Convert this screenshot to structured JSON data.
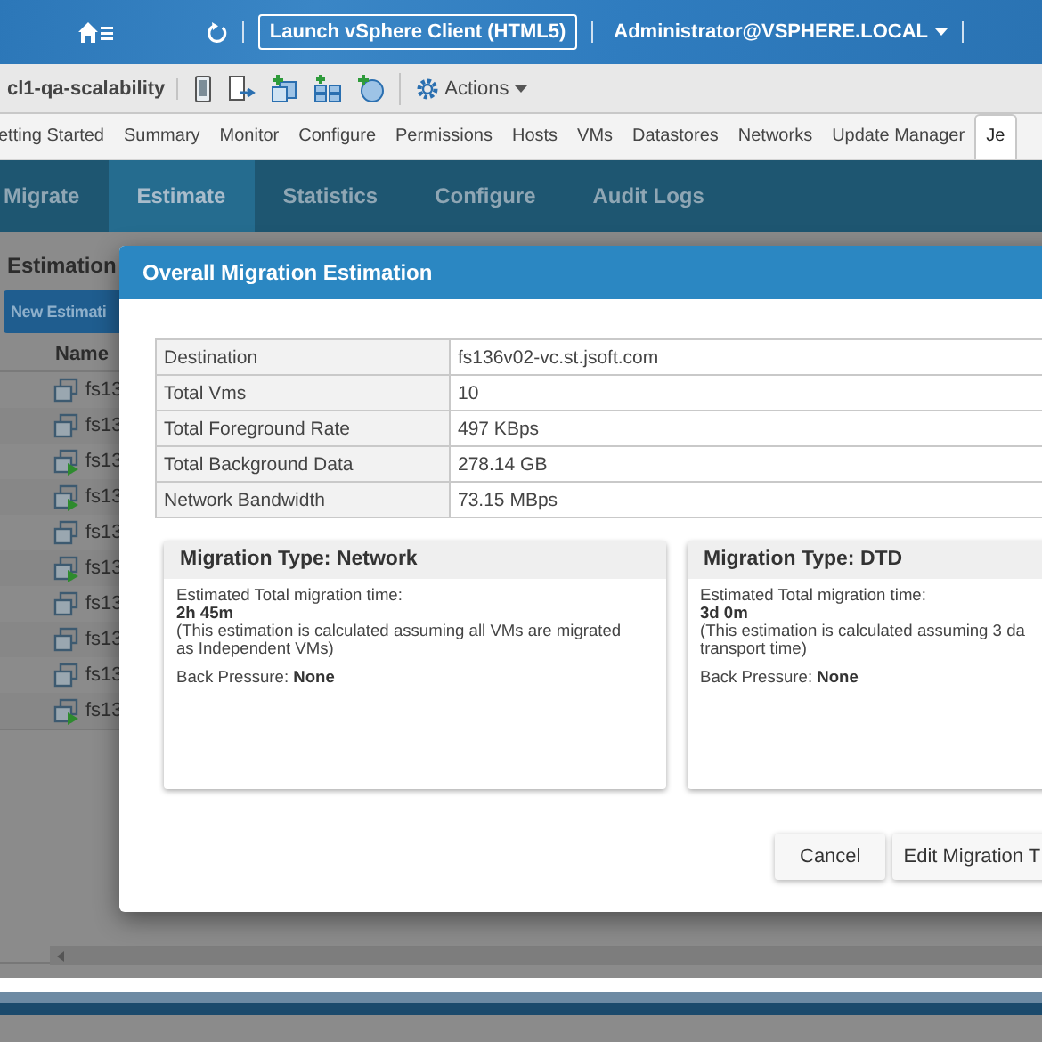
{
  "top_bar": {
    "launch_button": "Launch vSphere Client (HTML5)",
    "user_menu": "Administrator@VSPHERE.LOCAL"
  },
  "toolbar": {
    "object_name": "cl1-qa-scalability",
    "actions": "Actions"
  },
  "tabs": [
    {
      "label": "etting Started",
      "selected": false
    },
    {
      "label": "Summary",
      "selected": false
    },
    {
      "label": "Monitor",
      "selected": false
    },
    {
      "label": "Configure",
      "selected": false
    },
    {
      "label": "Permissions",
      "selected": false
    },
    {
      "label": "Hosts",
      "selected": false
    },
    {
      "label": "VMs",
      "selected": false
    },
    {
      "label": "Datastores",
      "selected": false
    },
    {
      "label": "Networks",
      "selected": false
    },
    {
      "label": "Update Manager",
      "selected": false
    },
    {
      "label": "Je",
      "selected": true
    }
  ],
  "subnav": [
    {
      "label": "Migrate",
      "selected": false
    },
    {
      "label": "Estimate",
      "selected": true
    },
    {
      "label": "Statistics",
      "selected": false
    },
    {
      "label": "Configure",
      "selected": false
    },
    {
      "label": "Audit Logs",
      "selected": false
    }
  ],
  "estimation_panel": {
    "title": "Estimation",
    "new_button": "New Estimati",
    "column": "Name",
    "rows": [
      {
        "name": "fs13",
        "powered_on": false
      },
      {
        "name": "fs13",
        "powered_on": false
      },
      {
        "name": "fs13",
        "powered_on": true
      },
      {
        "name": "fs13",
        "powered_on": true
      },
      {
        "name": "fs13",
        "powered_on": false
      },
      {
        "name": "fs13",
        "powered_on": true
      },
      {
        "name": "fs13",
        "powered_on": false
      },
      {
        "name": "fs13",
        "powered_on": false
      },
      {
        "name": "fs13",
        "powered_on": false
      },
      {
        "name": "fs13",
        "powered_on": true
      }
    ]
  },
  "dialog": {
    "title": "Overall Migration Estimation",
    "summary": [
      {
        "label": "Destination",
        "value": "fs136v02-vc.st.jsoft.com"
      },
      {
        "label": "Total Vms",
        "value": "10"
      },
      {
        "label": "Total Foreground Rate",
        "value": "497 KBps"
      },
      {
        "label": "Total Background Data",
        "value": "278.14 GB"
      },
      {
        "label": "Network Bandwidth",
        "value": "73.15 MBps"
      }
    ],
    "cards": [
      {
        "title": "Migration Type: Network",
        "time_label": "Estimated Total migration time:",
        "time": "2h 45m",
        "note_lines": [
          "(This estimation is calculated assuming all VMs are migrated",
          "as Independent VMs)"
        ],
        "pressure_label": "Back Pressure:",
        "pressure": "None"
      },
      {
        "title": "Migration Type: DTD",
        "time_label": "Estimated Total migration time:",
        "time": "3d 0m",
        "note_lines": [
          "(This estimation is calculated assuming 3 da",
          "transport time)"
        ],
        "pressure_label": "Back Pressure:",
        "pressure": "None"
      }
    ],
    "buttons": [
      "Cancel",
      "Edit Migration T"
    ]
  }
}
